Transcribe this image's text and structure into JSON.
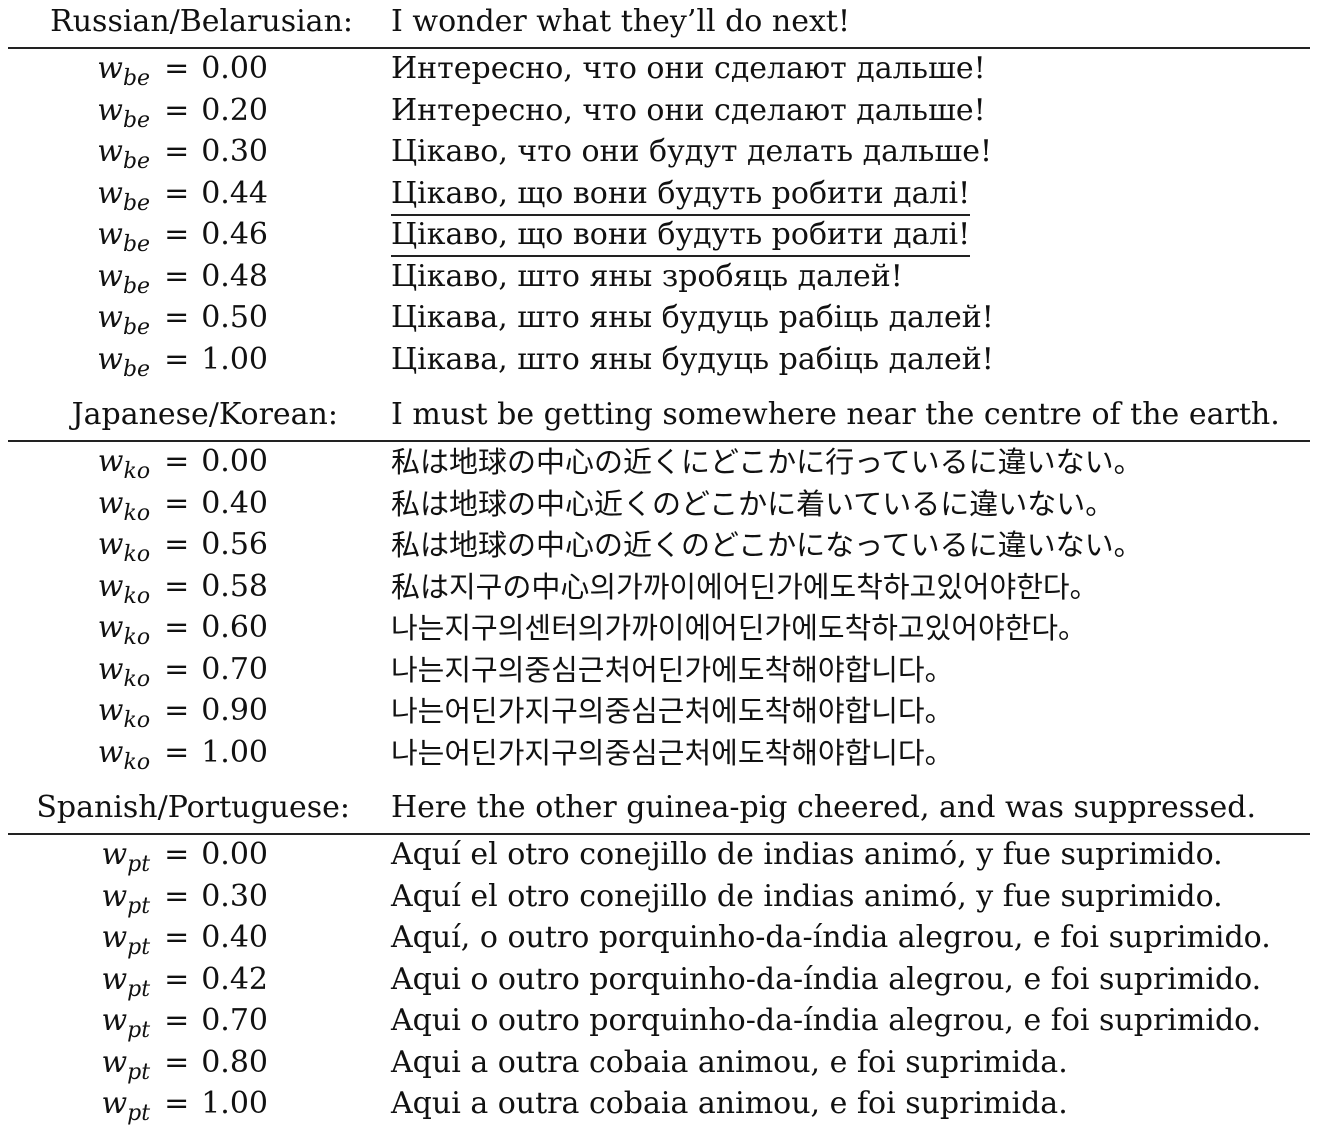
{
  "sections": [
    {
      "language_pair": "Russian/Belarusian:",
      "source": "I wonder what they’ll do next!",
      "weight_symbol": "w",
      "weight_subscript": "be",
      "rows": [
        {
          "weight": "0.00",
          "output": "Интересно, что они сделают дальше!"
        },
        {
          "weight": "0.20",
          "output": "Интересно, что они сделают дальше!"
        },
        {
          "weight": "0.30",
          "output": "Цікаво, что они будут делать дальше!"
        },
        {
          "weight": "0.44",
          "output": "Цікаво, що вони будуть робити далі!"
        },
        {
          "weight": "0.46",
          "output": "Цікаво, що вони будуть робити далі!"
        },
        {
          "weight": "0.48",
          "output": "Цікаво, што яны зробяць далей!"
        },
        {
          "weight": "0.50",
          "output": "Цікава, што яны будуць рабіць далей!"
        },
        {
          "weight": "1.00",
          "output": "Цікава, што яны будуць рабіць далей!"
        }
      ]
    },
    {
      "language_pair": "Japanese/Korean:",
      "source": "I must be getting somewhere near the centre of the earth.",
      "weight_symbol": "w",
      "weight_subscript": "ko",
      "rows": [
        {
          "weight": "0.00",
          "output": "私は地球の中心の近くにどこかに行っているに違いない。"
        },
        {
          "weight": "0.40",
          "output": "私は地球の中心近くのどこかに着いているに違いない。"
        },
        {
          "weight": "0.56",
          "output": "私は地球の中心の近くのどこかになっているに違いない。"
        },
        {
          "weight": "0.58",
          "output": "私は지구の中心의가까이에어딘가에도착하고있어야한다。"
        },
        {
          "weight": "0.60",
          "output": "나는지구의센터의가까이에어딘가에도착하고있어야한다。"
        },
        {
          "weight": "0.70",
          "output": "나는지구의중심근처어딘가에도착해야합니다。"
        },
        {
          "weight": "0.90",
          "output": "나는어딘가지구의중심근처에도착해야합니다。"
        },
        {
          "weight": "1.00",
          "output": "나는어딘가지구의중심근처에도착해야합니다。"
        }
      ]
    },
    {
      "language_pair": "Spanish/Portuguese:",
      "source": "Here the other guinea-pig cheered, and was suppressed.",
      "weight_symbol": "w",
      "weight_subscript": "pt",
      "rows": [
        {
          "weight": "0.00",
          "output": "Aquí el otro conejillo de indias animó, y fue suprimido."
        },
        {
          "weight": "0.30",
          "output": "Aquí el otro conejillo de indias animó, y fue suprimido."
        },
        {
          "weight": "0.40",
          "output": "Aquí, o outro porquinho-da-índia alegrou, e foi suprimido."
        },
        {
          "weight": "0.42",
          "output": "Aqui o outro porquinho-da-índia alegrou, e foi suprimido."
        },
        {
          "weight": "0.70",
          "output": "Aqui o outro porquinho-da-índia alegrou, e foi suprimido."
        },
        {
          "weight": "0.80",
          "output": "Aqui a outra cobaia animou, e foi suprimida."
        },
        {
          "weight": "1.00",
          "output": "Aqui a outra cobaia animou, e foi suprimida."
        }
      ]
    }
  ]
}
